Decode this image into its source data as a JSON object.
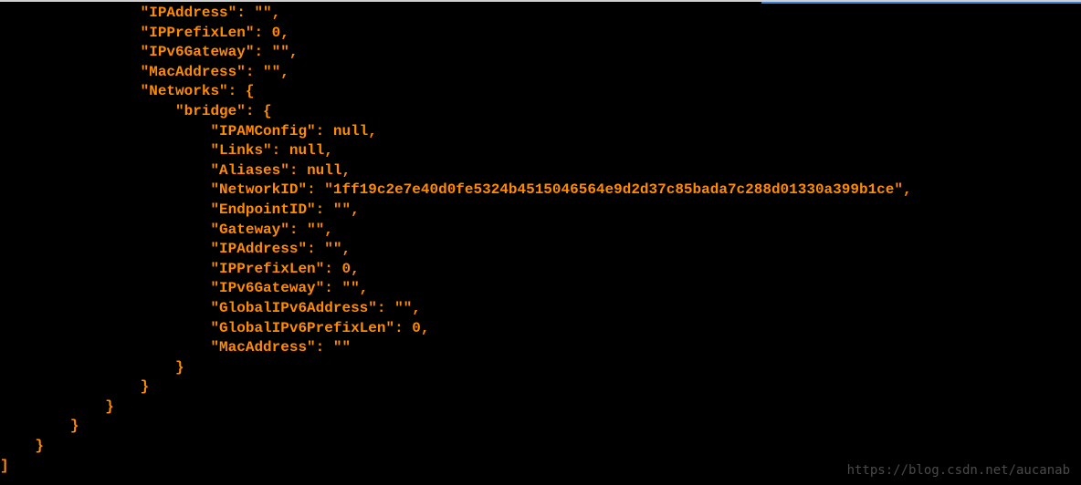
{
  "terminal": {
    "indent": {
      "l0": "",
      "l1": "    ",
      "l2": "        ",
      "l3": "            ",
      "l4": "                ",
      "l5": "                    ",
      "l6": "                        "
    },
    "lines": [
      {
        "indent": "l4",
        "key": "\"IPAddress\"",
        "colon": ": ",
        "value": "\"\"",
        "trail": ","
      },
      {
        "indent": "l4",
        "key": "\"IPPrefixLen\"",
        "colon": ": ",
        "value": "0",
        "trail": ","
      },
      {
        "indent": "l4",
        "key": "\"IPv6Gateway\"",
        "colon": ": ",
        "value": "\"\"",
        "trail": ","
      },
      {
        "indent": "l4",
        "key": "\"MacAddress\"",
        "colon": ": ",
        "value": "\"\"",
        "trail": ","
      },
      {
        "indent": "l4",
        "key": "\"Networks\"",
        "colon": ": ",
        "value": "{",
        "trail": ""
      },
      {
        "indent": "l5",
        "key": "\"bridge\"",
        "colon": ": ",
        "value": "{",
        "trail": ""
      },
      {
        "indent": "l6",
        "key": "\"IPAMConfig\"",
        "colon": ": ",
        "value": "null",
        "trail": ","
      },
      {
        "indent": "l6",
        "key": "\"Links\"",
        "colon": ": ",
        "value": "null",
        "trail": ","
      },
      {
        "indent": "l6",
        "key": "\"Aliases\"",
        "colon": ": ",
        "value": "null",
        "trail": ","
      },
      {
        "indent": "l6",
        "key": "\"NetworkID\"",
        "colon": ": ",
        "value": "\"1ff19c2e7e40d0fe5324b4515046564e9d2d37c85bada7c288d01330a399b1ce\"",
        "trail": ","
      },
      {
        "indent": "l6",
        "key": "\"EndpointID\"",
        "colon": ": ",
        "value": "\"\"",
        "trail": ","
      },
      {
        "indent": "l6",
        "key": "\"Gateway\"",
        "colon": ": ",
        "value": "\"\"",
        "trail": ","
      },
      {
        "indent": "l6",
        "key": "\"IPAddress\"",
        "colon": ": ",
        "value": "\"\"",
        "trail": ","
      },
      {
        "indent": "l6",
        "key": "\"IPPrefixLen\"",
        "colon": ": ",
        "value": "0",
        "trail": ","
      },
      {
        "indent": "l6",
        "key": "\"IPv6Gateway\"",
        "colon": ": ",
        "value": "\"\"",
        "trail": ","
      },
      {
        "indent": "l6",
        "key": "\"GlobalIPv6Address\"",
        "colon": ": ",
        "value": "\"\"",
        "trail": ","
      },
      {
        "indent": "l6",
        "key": "\"GlobalIPv6PrefixLen\"",
        "colon": ": ",
        "value": "0",
        "trail": ","
      },
      {
        "indent": "l6",
        "key": "\"MacAddress\"",
        "colon": ": ",
        "value": "\"\"",
        "trail": ""
      },
      {
        "indent": "l5",
        "key": "",
        "colon": "",
        "value": "}",
        "trail": ""
      },
      {
        "indent": "l4",
        "key": "",
        "colon": "",
        "value": "}",
        "trail": ""
      },
      {
        "indent": "l3",
        "key": "",
        "colon": "",
        "value": "}",
        "trail": ""
      },
      {
        "indent": "l2",
        "key": "",
        "colon": "",
        "value": "}",
        "trail": ""
      },
      {
        "indent": "l1",
        "key": "",
        "colon": "",
        "value": "}",
        "trail": ""
      },
      {
        "indent": "l0",
        "key": "",
        "colon": "",
        "value": "]",
        "trail": ""
      }
    ]
  },
  "watermark": "https://blog.csdn.net/aucanab"
}
